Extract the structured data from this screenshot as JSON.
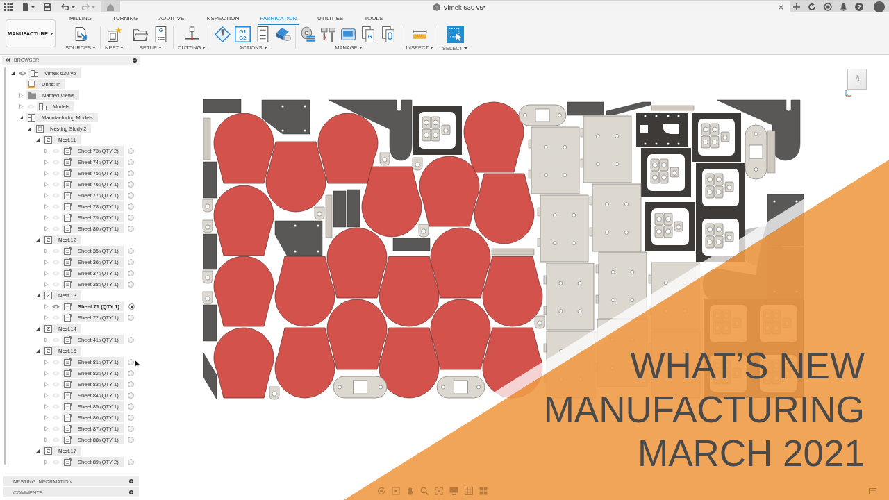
{
  "app_bar": {
    "document_title": "Vimek 630 v5*",
    "help_glyph": "?"
  },
  "ribbon": {
    "workspace": "MANUFACTURE",
    "tabs": [
      {
        "label": "MILLING",
        "selected": false
      },
      {
        "label": "TURNING",
        "selected": false
      },
      {
        "label": "ADDITIVE",
        "selected": false
      },
      {
        "label": "INSPECTION",
        "selected": false
      },
      {
        "label": "FABRICATION",
        "selected": true
      },
      {
        "label": "UTILITIES",
        "selected": false
      },
      {
        "label": "TOOLS",
        "selected": false
      }
    ],
    "groups": [
      {
        "label": "SOURCES",
        "tools": [
          {
            "kind": "sources"
          }
        ]
      },
      {
        "label": "NEST",
        "tools": [
          {
            "kind": "nest"
          }
        ]
      },
      {
        "label": "SETUP",
        "tools": [
          {
            "kind": "folder"
          },
          {
            "kind": "setup-sheet",
            "glyph": [
              "G"
            ]
          }
        ]
      },
      {
        "label": "CUTTING",
        "tools": [
          {
            "kind": "cutter"
          }
        ]
      },
      {
        "label": "ACTIONS",
        "tools": [
          {
            "kind": "simulate"
          },
          {
            "kind": "gcode",
            "glyph": [
              "G1",
              "G2"
            ]
          },
          {
            "kind": "sheet-list"
          },
          {
            "kind": "eraser"
          }
        ]
      },
      {
        "label": "MANAGE",
        "tools": [
          {
            "kind": "library"
          },
          {
            "kind": "tools"
          },
          {
            "kind": "machine"
          },
          {
            "kind": "nc-program",
            "glyph": [
              "G"
            ]
          },
          {
            "kind": "nc-link"
          }
        ]
      },
      {
        "label": "INSPECT",
        "tools": [
          {
            "kind": "measure"
          }
        ]
      },
      {
        "label": "SELECT",
        "tools": [
          {
            "kind": "select"
          }
        ]
      }
    ]
  },
  "browser": {
    "title": "BROWSER",
    "tree": [
      {
        "kind": "document",
        "label": "Vimek 630 v5",
        "expanded": true,
        "visible": true,
        "children": [
          {
            "kind": "units",
            "label": "Units: in"
          },
          {
            "kind": "folder",
            "label": "Named Views",
            "expanded": false
          },
          {
            "kind": "models",
            "label": "Models",
            "expanded": false,
            "visible": false
          },
          {
            "kind": "manufacturing-models",
            "label": "Manufacturing Models",
            "expanded": true,
            "children": [
              {
                "kind": "study",
                "label": "Nesting Study.2",
                "expanded": true,
                "children": [
                  {
                    "kind": "nest",
                    "label": "Nest.11",
                    "expanded": true,
                    "children": [
                      {
                        "kind": "sheet",
                        "label": "Sheet.73:(QTY 2)",
                        "expanded": false,
                        "visible": false,
                        "active": false
                      },
                      {
                        "kind": "sheet",
                        "label": "Sheet.74:(QTY 1)",
                        "expanded": false,
                        "visible": false,
                        "active": false
                      },
                      {
                        "kind": "sheet",
                        "label": "Sheet.75:(QTY 1)",
                        "expanded": false,
                        "visible": false,
                        "active": false
                      },
                      {
                        "kind": "sheet",
                        "label": "Sheet.76:(QTY 1)",
                        "expanded": false,
                        "visible": false,
                        "active": false
                      },
                      {
                        "kind": "sheet",
                        "label": "Sheet.77:(QTY 1)",
                        "expanded": false,
                        "visible": false,
                        "active": false
                      },
                      {
                        "kind": "sheet",
                        "label": "Sheet.78:(QTY 1)",
                        "expanded": false,
                        "visible": false,
                        "active": false
                      },
                      {
                        "kind": "sheet",
                        "label": "Sheet.79:(QTY 1)",
                        "expanded": false,
                        "visible": false,
                        "active": false
                      },
                      {
                        "kind": "sheet",
                        "label": "Sheet.80:(QTY 1)",
                        "expanded": false,
                        "visible": false,
                        "active": false
                      }
                    ]
                  },
                  {
                    "kind": "nest",
                    "label": "Nest.12",
                    "expanded": true,
                    "children": [
                      {
                        "kind": "sheet",
                        "label": "Sheet.35:(QTY 1)",
                        "expanded": false,
                        "visible": false,
                        "active": false
                      },
                      {
                        "kind": "sheet",
                        "label": "Sheet.36:(QTY 1)",
                        "expanded": false,
                        "visible": false,
                        "active": false
                      },
                      {
                        "kind": "sheet",
                        "label": "Sheet.37:(QTY 1)",
                        "expanded": false,
                        "visible": false,
                        "active": false
                      },
                      {
                        "kind": "sheet",
                        "label": "Sheet.38:(QTY 1)",
                        "expanded": false,
                        "visible": false,
                        "active": false
                      }
                    ]
                  },
                  {
                    "kind": "nest",
                    "label": "Nest.13",
                    "expanded": true,
                    "children": [
                      {
                        "kind": "sheet",
                        "label": "Sheet.71:(QTY 1)",
                        "expanded": false,
                        "visible": true,
                        "active": true
                      },
                      {
                        "kind": "sheet",
                        "label": "Sheet.72:(QTY 1)",
                        "expanded": false,
                        "visible": false,
                        "active": false
                      }
                    ]
                  },
                  {
                    "kind": "nest",
                    "label": "Nest.14",
                    "expanded": true,
                    "children": [
                      {
                        "kind": "sheet",
                        "label": "Sheet.41:(QTY 1)",
                        "expanded": false,
                        "visible": false,
                        "active": false
                      }
                    ]
                  },
                  {
                    "kind": "nest",
                    "label": "Nest.15",
                    "expanded": true,
                    "children": [
                      {
                        "kind": "sheet",
                        "label": "Sheet.81:(QTY 1)",
                        "expanded": false,
                        "visible": false,
                        "active": false
                      },
                      {
                        "kind": "sheet",
                        "label": "Sheet.82:(QTY 1)",
                        "expanded": false,
                        "visible": false,
                        "active": false
                      },
                      {
                        "kind": "sheet",
                        "label": "Sheet.83:(QTY 1)",
                        "expanded": false,
                        "visible": false,
                        "active": false
                      },
                      {
                        "kind": "sheet",
                        "label": "Sheet.84:(QTY 1)",
                        "expanded": false,
                        "visible": false,
                        "active": false
                      },
                      {
                        "kind": "sheet",
                        "label": "Sheet.85:(QTY 1)",
                        "expanded": false,
                        "visible": false,
                        "active": false
                      },
                      {
                        "kind": "sheet",
                        "label": "Sheet.86:(QTY 1)",
                        "expanded": false,
                        "visible": false,
                        "active": false
                      },
                      {
                        "kind": "sheet",
                        "label": "Sheet.87:(QTY 1)",
                        "expanded": false,
                        "visible": false,
                        "active": false
                      },
                      {
                        "kind": "sheet",
                        "label": "Sheet.88:(QTY 1)",
                        "expanded": false,
                        "visible": false,
                        "active": false
                      }
                    ]
                  },
                  {
                    "kind": "nest",
                    "label": "Nest.17",
                    "expanded": true,
                    "children": [
                      {
                        "kind": "sheet",
                        "label": "Sheet.89:(QTY 2)",
                        "expanded": false,
                        "visible": false,
                        "active": false
                      }
                    ]
                  }
                ]
              }
            ]
          }
        ]
      }
    ]
  },
  "bottom_panels": [
    {
      "title": "NESTING INFORMATION"
    },
    {
      "title": "COMMENTS"
    }
  ],
  "view_cube": {
    "face": "TOP"
  },
  "banner": {
    "lines": [
      "WHAT’S NEW",
      "MANUFACTURING",
      "MARCH 2021"
    ]
  }
}
